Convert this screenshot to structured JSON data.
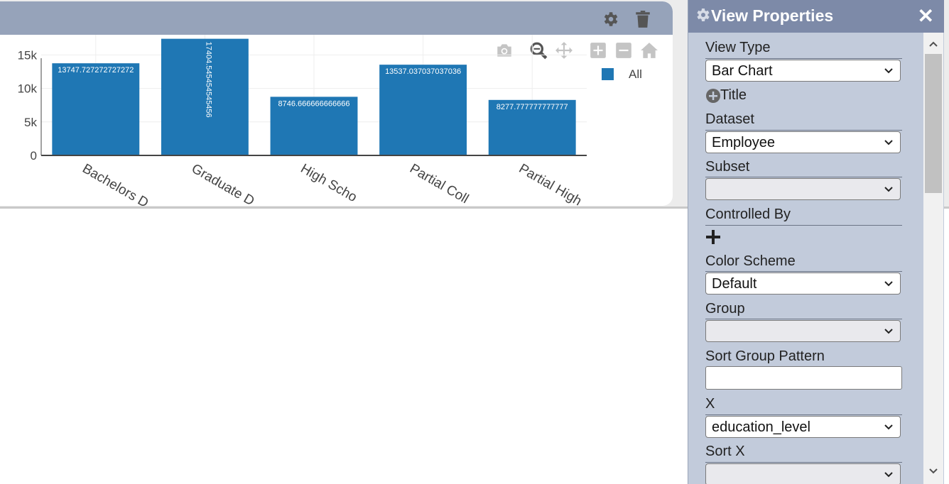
{
  "widget": {
    "toolbar_icons": [
      "gear-icon",
      "trash-icon"
    ],
    "modebar_icons": [
      "camera-icon",
      "zoom-icon",
      "pan-icon",
      "zoom-in-icon",
      "zoom-out-icon",
      "home-icon"
    ]
  },
  "chart_data": {
    "type": "bar",
    "categories": [
      "Bachelors Degree",
      "Graduate Degree",
      "High School",
      "Partial College",
      "Partial High School"
    ],
    "category_tick_labels": [
      "Bachelors D",
      "Graduate D",
      "High Scho",
      "Partial Coll",
      "Partial High"
    ],
    "series": [
      {
        "name": "All",
        "color": "#1f77b4",
        "values": [
          13747.727272727272,
          17404.545454545456,
          8746.666666666666,
          13537.037037037036,
          8277.777777777777
        ],
        "value_labels": [
          "13747.727272727272",
          "17404.545454545456",
          "8746.666666666666",
          "13537.037037037036",
          "8277.777777777777"
        ]
      }
    ],
    "yticks": [
      0,
      5000,
      10000,
      15000
    ],
    "ytick_labels": [
      "0",
      "5k",
      "10k",
      "15k"
    ],
    "ylim": [
      0,
      18000
    ],
    "xlabel": "",
    "ylabel": "",
    "grid": true,
    "legend": "top-right"
  },
  "panel": {
    "title": "View Properties",
    "close_glyph": "✕",
    "view_type_label": "View Type",
    "view_type_value": "Bar Chart",
    "title_label": "Title",
    "dataset_label": "Dataset",
    "dataset_value": "Employee",
    "subset_label": "Subset",
    "subset_value": "",
    "controlled_by_label": "Controlled By",
    "color_scheme_label": "Color Scheme",
    "color_scheme_value": "Default",
    "group_label": "Group",
    "group_value": "",
    "sort_group_pattern_label": "Sort Group Pattern",
    "sort_group_pattern_value": "",
    "x_label": "X",
    "x_value": "education_level",
    "sort_x_label": "Sort X",
    "sort_x_value": ""
  },
  "colors": {
    "bar": "#1f77b4",
    "header": "#96a3ba",
    "panel_bg": "#c2cbdb",
    "panel_header": "#7d8aa8"
  }
}
